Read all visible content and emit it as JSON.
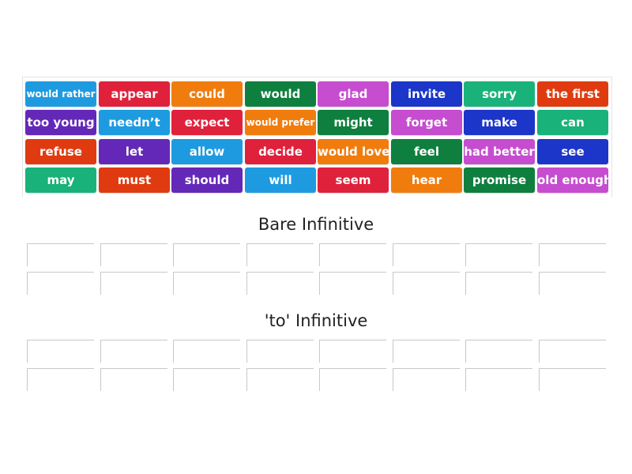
{
  "colors": {
    "blue": "#1e9be0",
    "red": "#e0213c",
    "orange": "#f07c0e",
    "green": "#0e7f3e",
    "magenta": "#c64dcf",
    "navy": "#1b36c8",
    "teal": "#19b27b",
    "vermilion": "#e03b10",
    "purple": "#6428b8"
  },
  "tiles": [
    {
      "label": "would rather",
      "color": "blue",
      "small": true
    },
    {
      "label": "appear",
      "color": "red"
    },
    {
      "label": "could",
      "color": "orange"
    },
    {
      "label": "would",
      "color": "green"
    },
    {
      "label": "glad",
      "color": "magenta"
    },
    {
      "label": "invite",
      "color": "navy"
    },
    {
      "label": "sorry",
      "color": "teal"
    },
    {
      "label": "the first",
      "color": "vermilion"
    },
    {
      "label": "too young",
      "color": "purple"
    },
    {
      "label": "needn’t",
      "color": "blue"
    },
    {
      "label": "expect",
      "color": "red"
    },
    {
      "label": "would prefer",
      "color": "orange",
      "small": true
    },
    {
      "label": "might",
      "color": "green"
    },
    {
      "label": "forget",
      "color": "magenta"
    },
    {
      "label": "make",
      "color": "navy"
    },
    {
      "label": "can",
      "color": "teal"
    },
    {
      "label": "refuse",
      "color": "vermilion"
    },
    {
      "label": "let",
      "color": "purple"
    },
    {
      "label": "allow",
      "color": "blue"
    },
    {
      "label": "decide",
      "color": "red"
    },
    {
      "label": "would love",
      "color": "orange"
    },
    {
      "label": "feel",
      "color": "green"
    },
    {
      "label": "had better",
      "color": "magenta"
    },
    {
      "label": "see",
      "color": "navy"
    },
    {
      "label": "may",
      "color": "teal"
    },
    {
      "label": "must",
      "color": "vermilion"
    },
    {
      "label": "should",
      "color": "purple"
    },
    {
      "label": "will",
      "color": "blue"
    },
    {
      "label": "seem",
      "color": "red"
    },
    {
      "label": "hear",
      "color": "orange"
    },
    {
      "label": "promise",
      "color": "green"
    },
    {
      "label": "old enough",
      "color": "magenta"
    }
  ],
  "groups": [
    {
      "title": "Bare Infinitive",
      "slot_count": 16
    },
    {
      "title": "'to' Infinitive",
      "slot_count": 16
    }
  ]
}
